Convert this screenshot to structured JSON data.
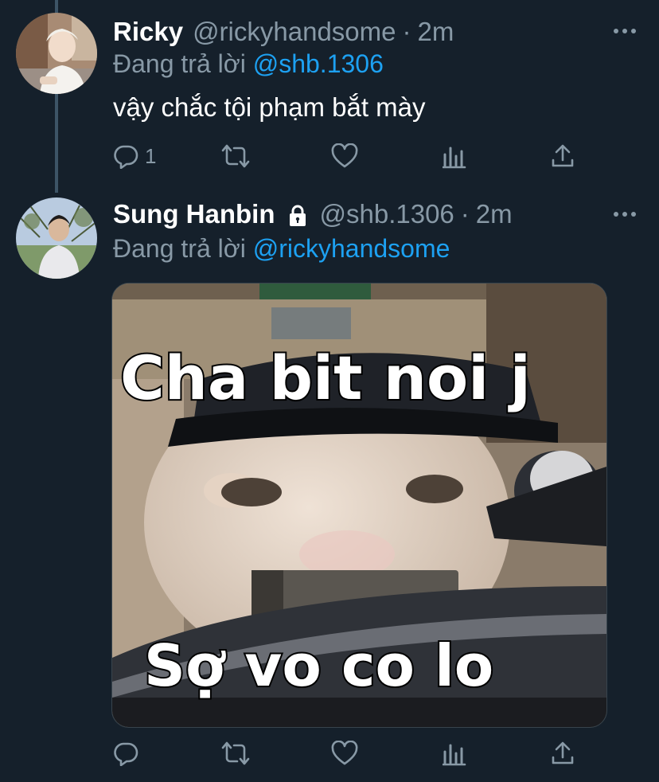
{
  "tweets": [
    {
      "name": "Ricky",
      "handle": "@rickyhandsome",
      "separator": "·",
      "time": "2m",
      "reply_prefix": "Đang trả lời ",
      "reply_to": "@shb.1306",
      "text": "vậy chắc tội phạm bắt mày",
      "reply_count": "1",
      "protected": false
    },
    {
      "name": "Sung Hanbin",
      "handle": "@shb.1306",
      "separator": "·",
      "time": "2m",
      "reply_prefix": "Đang trả lời ",
      "reply_to": "@rickyhandsome",
      "media_caption_top": "Cha bit noi j",
      "media_caption_bottom": "Sợ vo co lo",
      "reply_count": "",
      "protected": true
    }
  ],
  "colors": {
    "background": "#15202b",
    "secondary_text": "#8899a6",
    "accent": "#1da1f2"
  },
  "icons": [
    "reply-icon",
    "retweet-icon",
    "like-icon",
    "analytics-icon",
    "share-icon",
    "more-icon",
    "lock-icon"
  ]
}
